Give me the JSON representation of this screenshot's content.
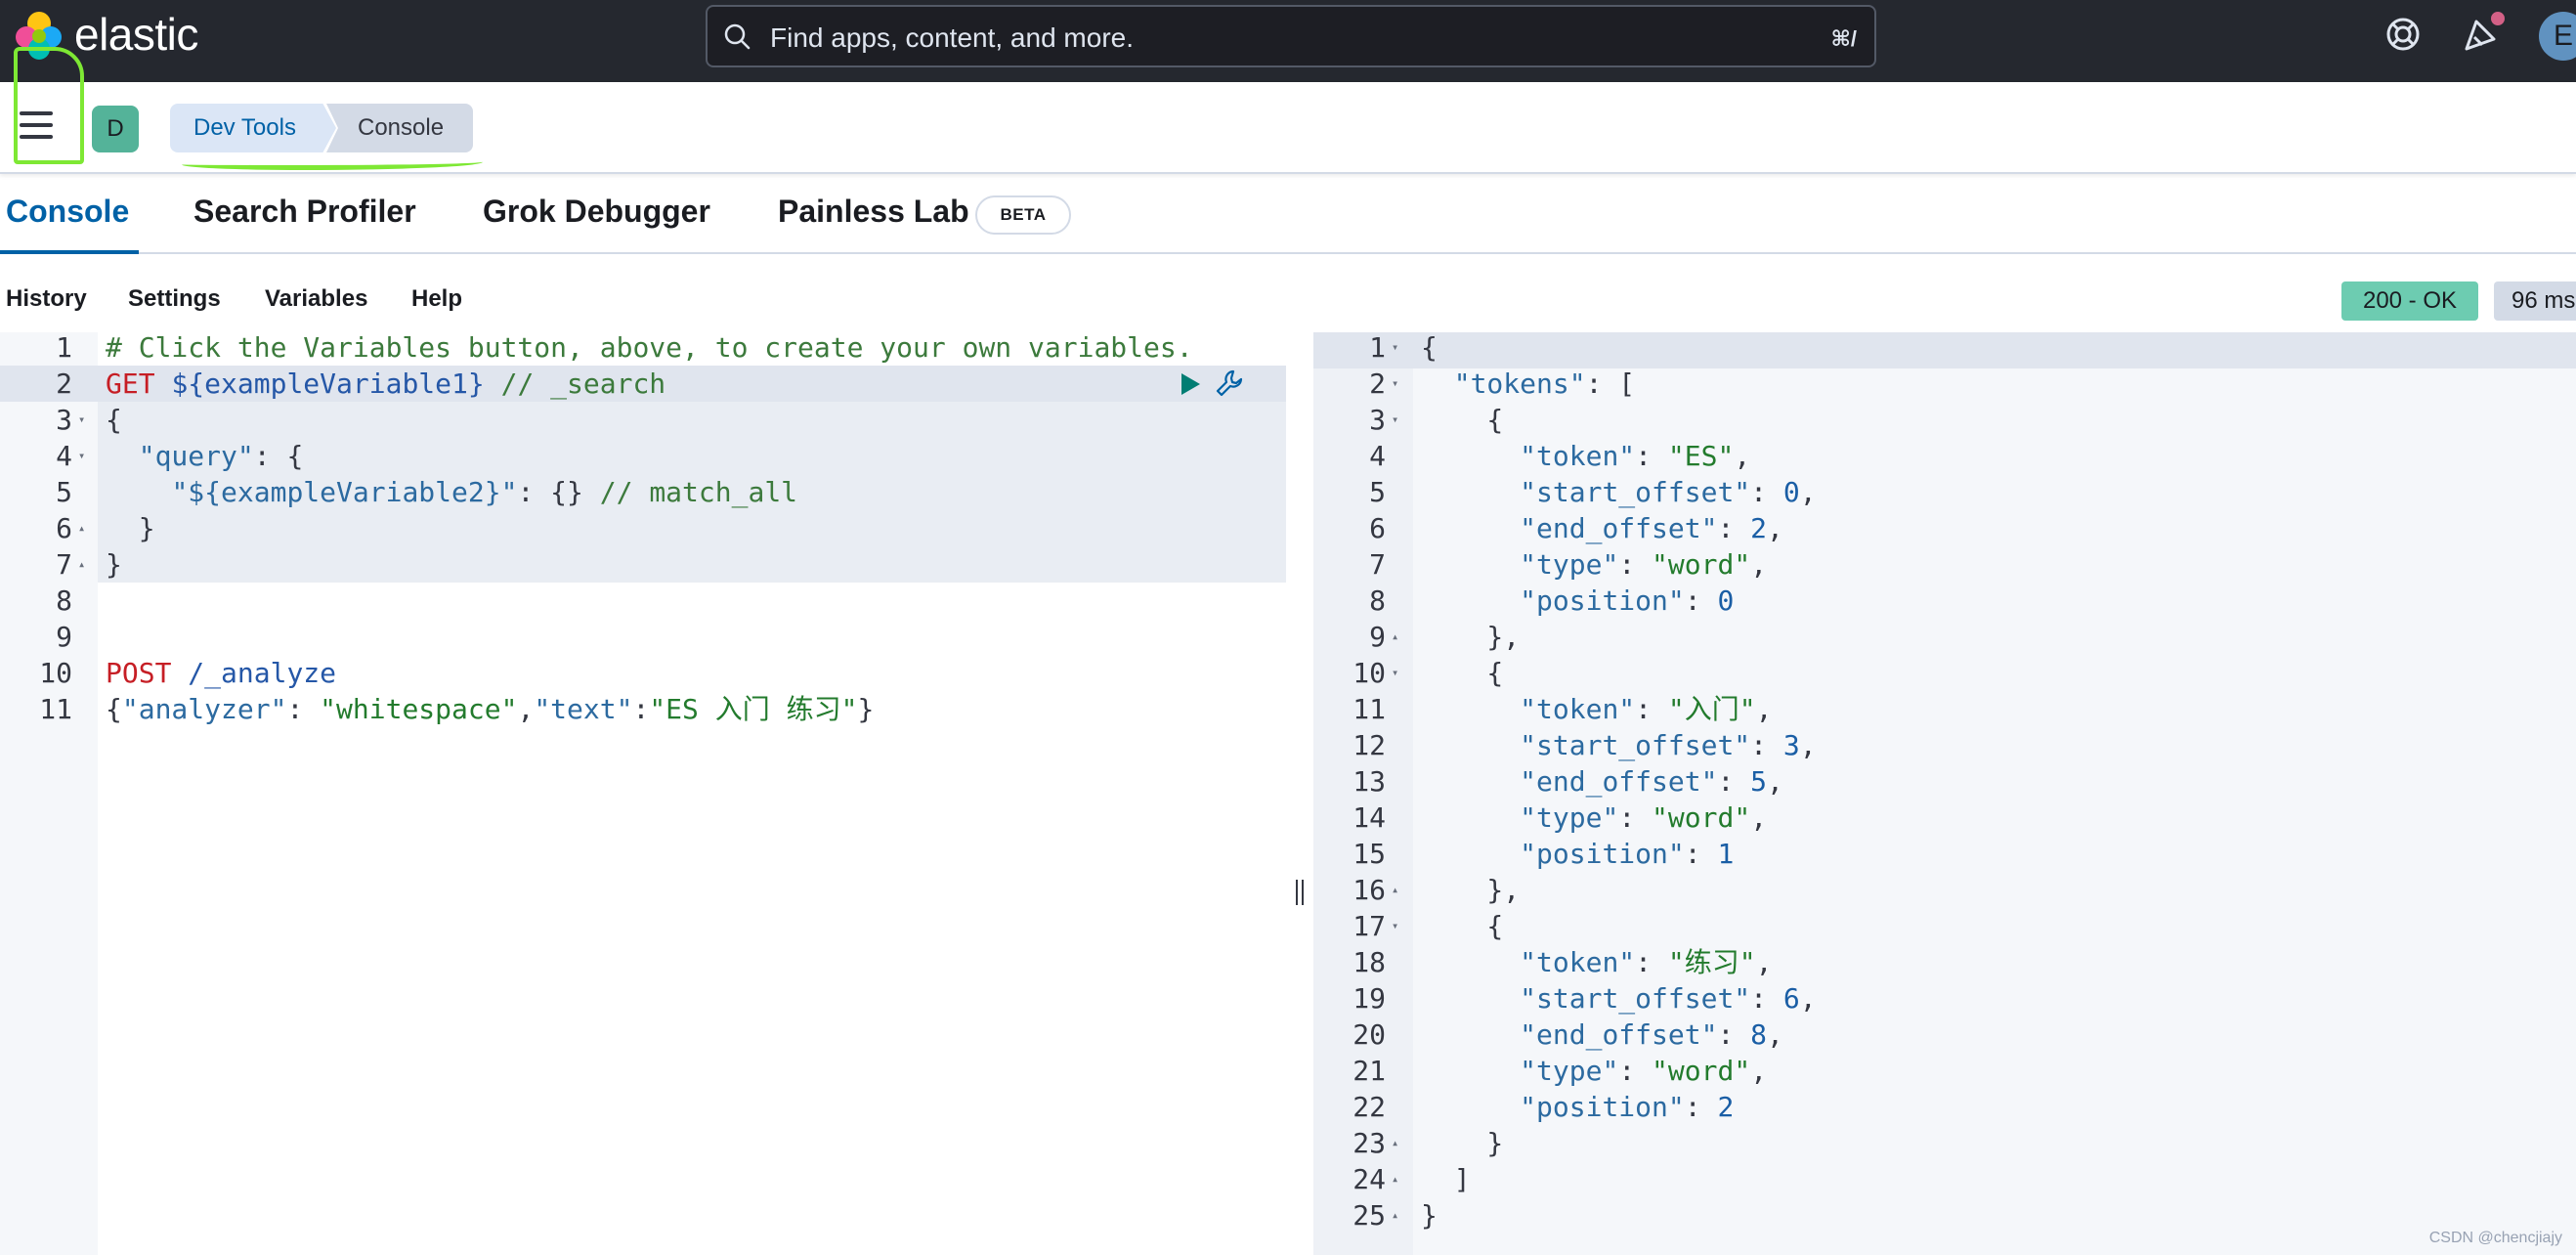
{
  "header": {
    "brand": "elastic",
    "search_placeholder": "Find apps, content, and more.",
    "search_shortcut": "⌘/",
    "user_initial": "E",
    "colors": {
      "header_bg": "#25282f",
      "accent": "#0061a6",
      "success": "#6dccb1"
    }
  },
  "subheader": {
    "space_initial": "D",
    "breadcrumbs": [
      "Dev Tools",
      "Console"
    ]
  },
  "tabs": [
    {
      "label": "Console",
      "active": true
    },
    {
      "label": "Search Profiler"
    },
    {
      "label": "Grok Debugger"
    },
    {
      "label": "Painless Lab",
      "badge": "BETA"
    }
  ],
  "console_menu": [
    "History",
    "Settings",
    "Variables",
    "Help"
  ],
  "response_status": {
    "status": "200 - OK",
    "time": "96 ms"
  },
  "request_editor": {
    "lines": [
      "# Click the Variables button, above, to create your own variables.",
      "GET ${exampleVariable1} // _search",
      "{",
      "  \"query\": {",
      "    \"${exampleVariable2}\": {} // match_all",
      "  }",
      "}",
      "",
      "",
      "POST /_analyze",
      "{\"analyzer\": \"whitespace\",\"text\":\"ES 入门 练习\"}"
    ]
  },
  "response_editor": {
    "lines": [
      "{",
      "  \"tokens\": [",
      "    {",
      "      \"token\": \"ES\",",
      "      \"start_offset\": 0,",
      "      \"end_offset\": 2,",
      "      \"type\": \"word\",",
      "      \"position\": 0",
      "    },",
      "    {",
      "      \"token\": \"入门\",",
      "      \"start_offset\": 3,",
      "      \"end_offset\": 5,",
      "      \"type\": \"word\",",
      "      \"position\": 1",
      "    },",
      "    {",
      "      \"token\": \"练习\",",
      "      \"start_offset\": 6,",
      "      \"end_offset\": 8,",
      "      \"type\": \"word\",",
      "      \"position\": 2",
      "    }",
      "  ]",
      "}"
    ]
  },
  "watermark": "CSDN @chencjiajy",
  "icons": [
    "elastic-logo-icon",
    "search-icon",
    "help-icon",
    "news-icon",
    "menu-icon",
    "run-icon",
    "wrench-icon"
  ]
}
